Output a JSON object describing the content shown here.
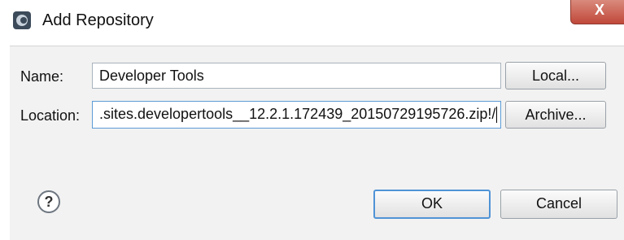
{
  "window": {
    "title": "Add Repository",
    "close_label": "X"
  },
  "icons": {
    "app": "eclipse-app-icon",
    "help": "help-icon",
    "close": "close-icon"
  },
  "form": {
    "name_label": "Name:",
    "name_value": "Developer Tools",
    "location_label": "Location:",
    "location_value": ".sites.developertools__12.2.1.172439_20150729195726.zip!/"
  },
  "buttons": {
    "local": "Local...",
    "archive": "Archive...",
    "ok": "OK",
    "cancel": "Cancel"
  },
  "help": {
    "glyph": "?"
  },
  "colors": {
    "close_button": "#c0483a",
    "default_button_border": "#4f93d6",
    "dialog_background": "#f2f2f2"
  }
}
